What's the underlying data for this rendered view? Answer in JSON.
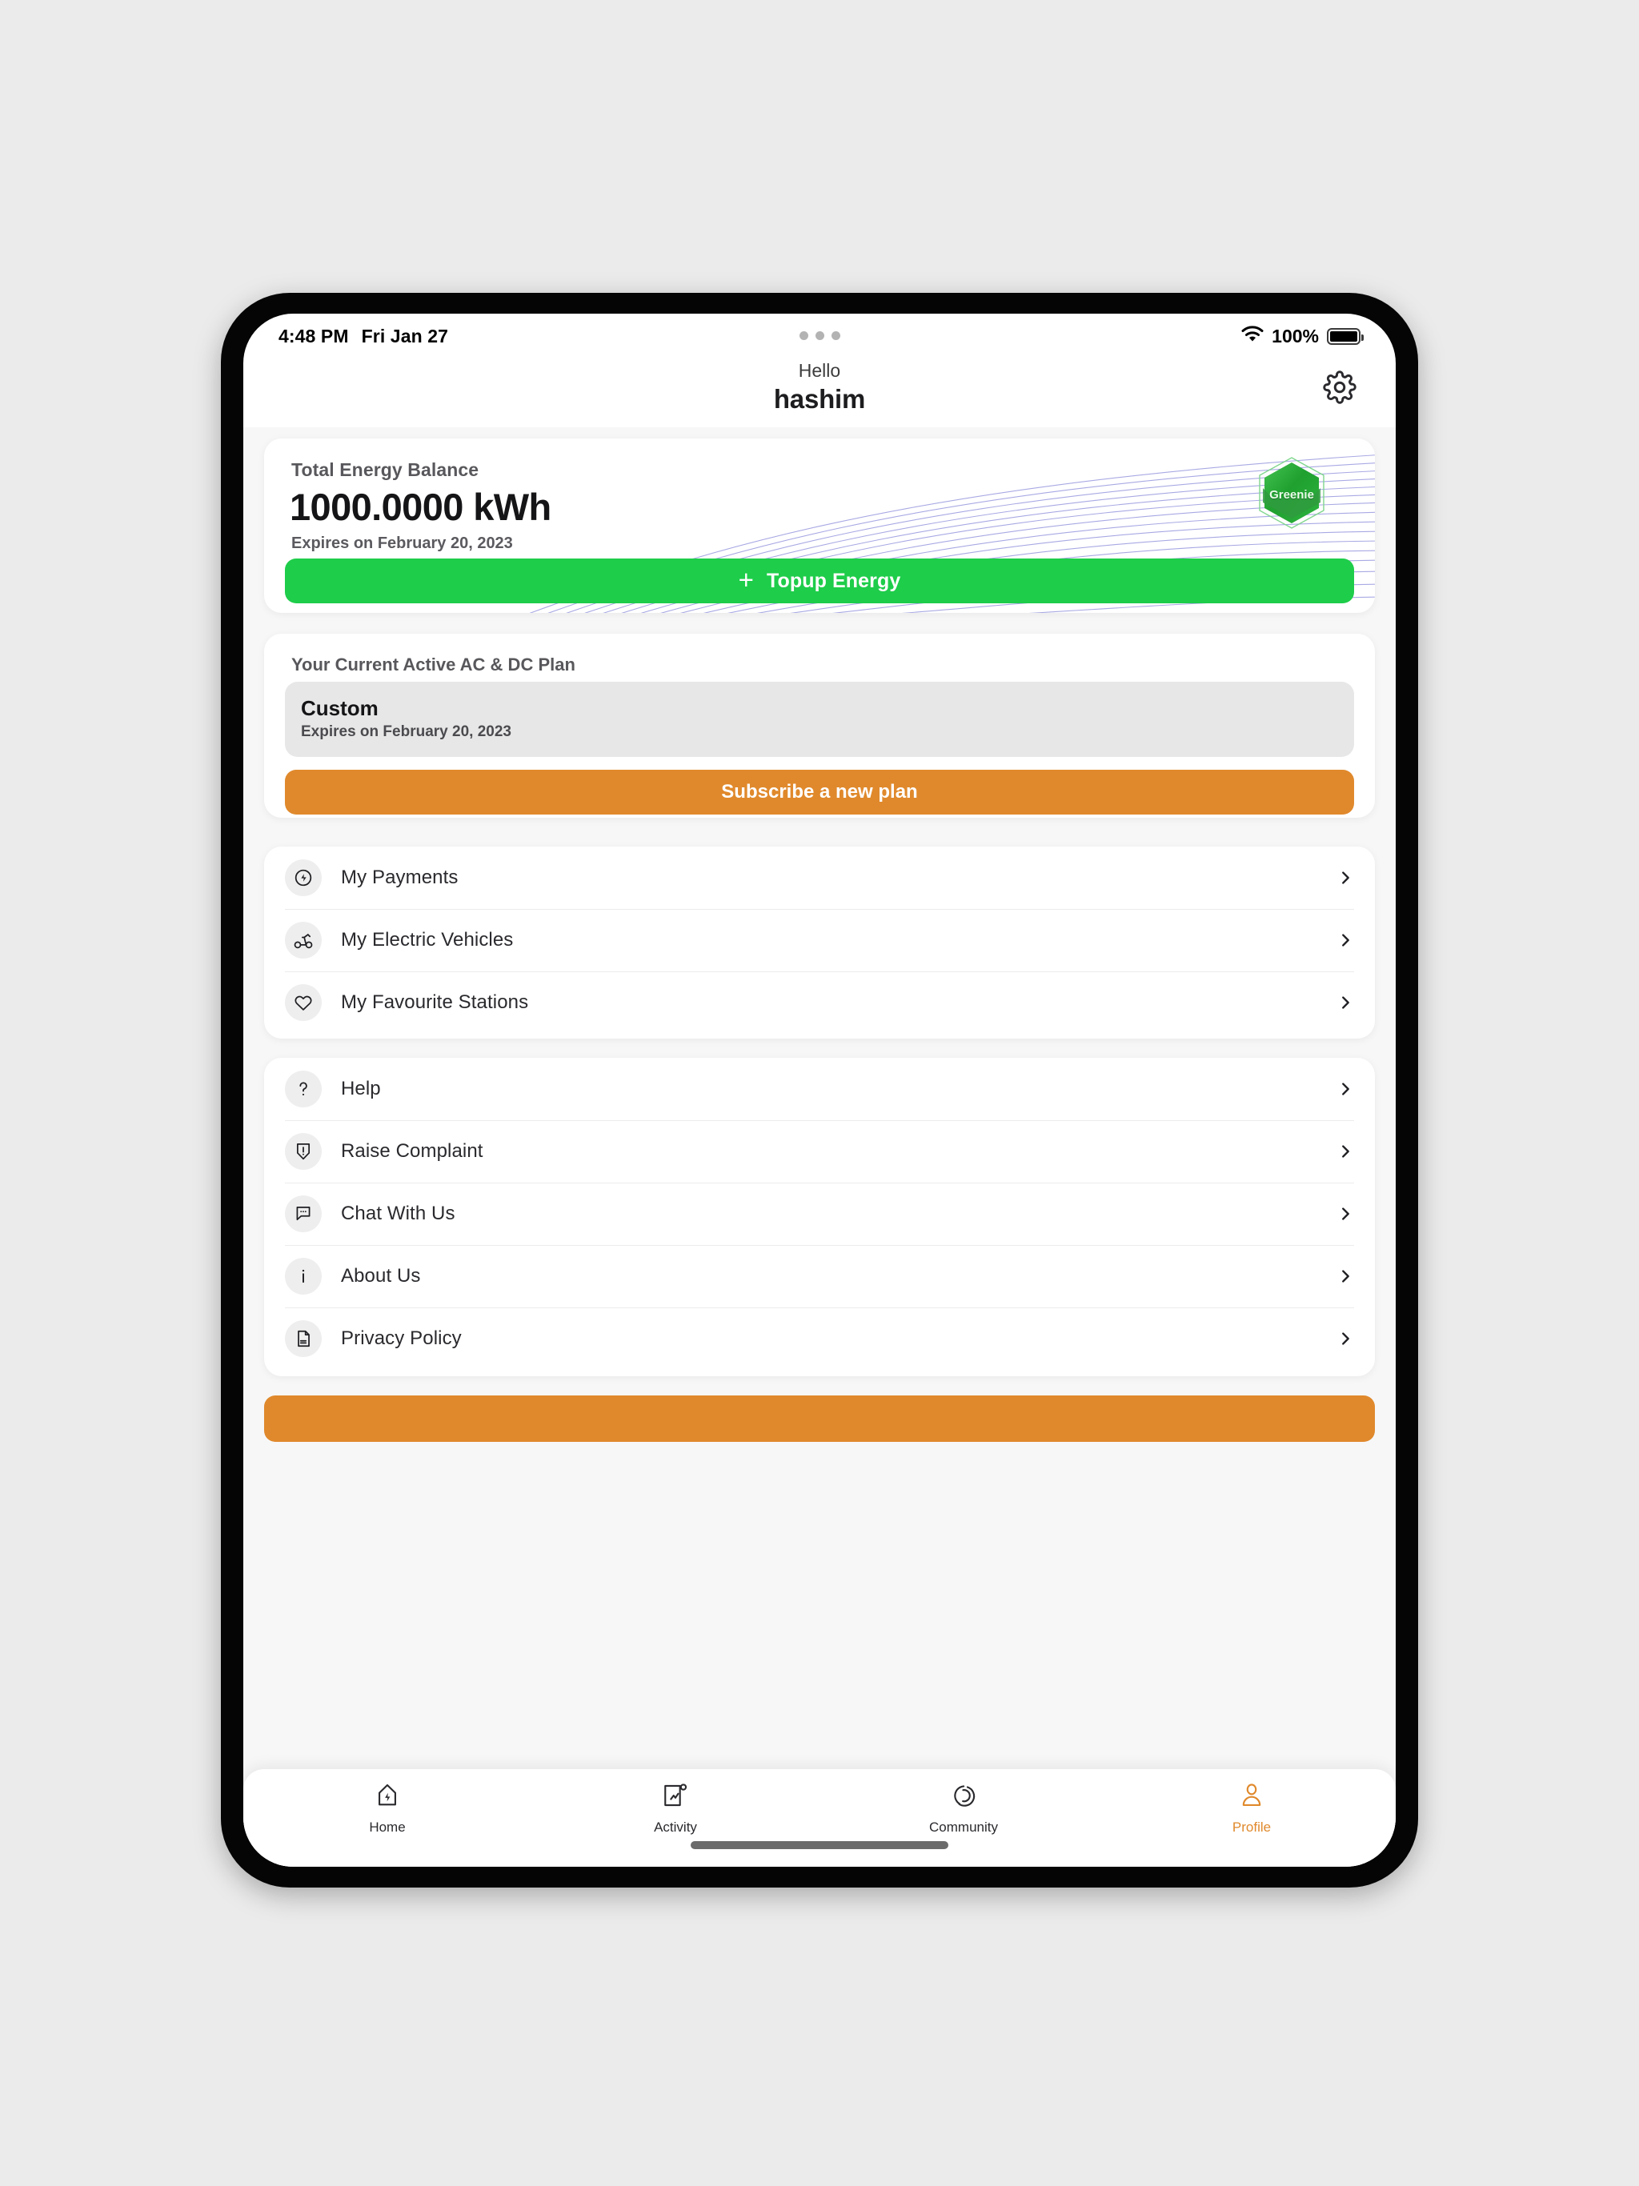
{
  "status_bar": {
    "time": "4:48 PM",
    "date": "Fri Jan 27",
    "battery_percent": "100%",
    "wifi_icon": "wifi-icon",
    "battery_icon": "battery-full-icon",
    "multitask_indicator": "three-dots-icon"
  },
  "header": {
    "greeting": "Hello",
    "user_name": "hashim",
    "settings_icon": "gear-icon"
  },
  "balance_card": {
    "title": "Total Energy Balance",
    "value": "1000.0000 kWh",
    "expiry": "Expires on February 20, 2023",
    "badge_label": "Greenie",
    "badge_icon": "hexagon-badge-icon",
    "topup_button": "Topup Energy",
    "topup_icon": "plus-icon"
  },
  "plan_card": {
    "title": "Your Current Active AC & DC Plan",
    "plan_name": "Custom",
    "plan_expiry": "Expires on February 20, 2023",
    "subscribe_button": "Subscribe a new plan"
  },
  "menu_group_1": [
    {
      "label": "My Payments",
      "icon": "bolt-circle-icon"
    },
    {
      "label": "My Electric Vehicles",
      "icon": "scooter-icon"
    },
    {
      "label": "My Favourite Stations",
      "icon": "heart-icon"
    }
  ],
  "menu_group_2": [
    {
      "label": "Help",
      "icon": "question-mark-icon"
    },
    {
      "label": "Raise Complaint",
      "icon": "shield-alert-icon"
    },
    {
      "label": "Chat With Us",
      "icon": "chat-bubble-icon"
    },
    {
      "label": "About Us",
      "icon": "info-icon"
    },
    {
      "label": "Privacy Policy",
      "icon": "document-icon"
    }
  ],
  "bottom_action": {
    "label": ""
  },
  "tab_bar": [
    {
      "label": "Home",
      "icon": "home-bolt-icon",
      "active": false
    },
    {
      "label": "Activity",
      "icon": "activity-chart-icon",
      "active": false
    },
    {
      "label": "Community",
      "icon": "community-circles-icon",
      "active": false
    },
    {
      "label": "Profile",
      "icon": "person-icon",
      "active": true
    }
  ],
  "colors": {
    "accent_green": "#1ecd4a",
    "accent_orange": "#e0892c",
    "page_background": "#f7f7f7",
    "card_background": "#ffffff",
    "wave_line": "#9a9ae0"
  },
  "chevron_icon": "chevron-right-icon"
}
